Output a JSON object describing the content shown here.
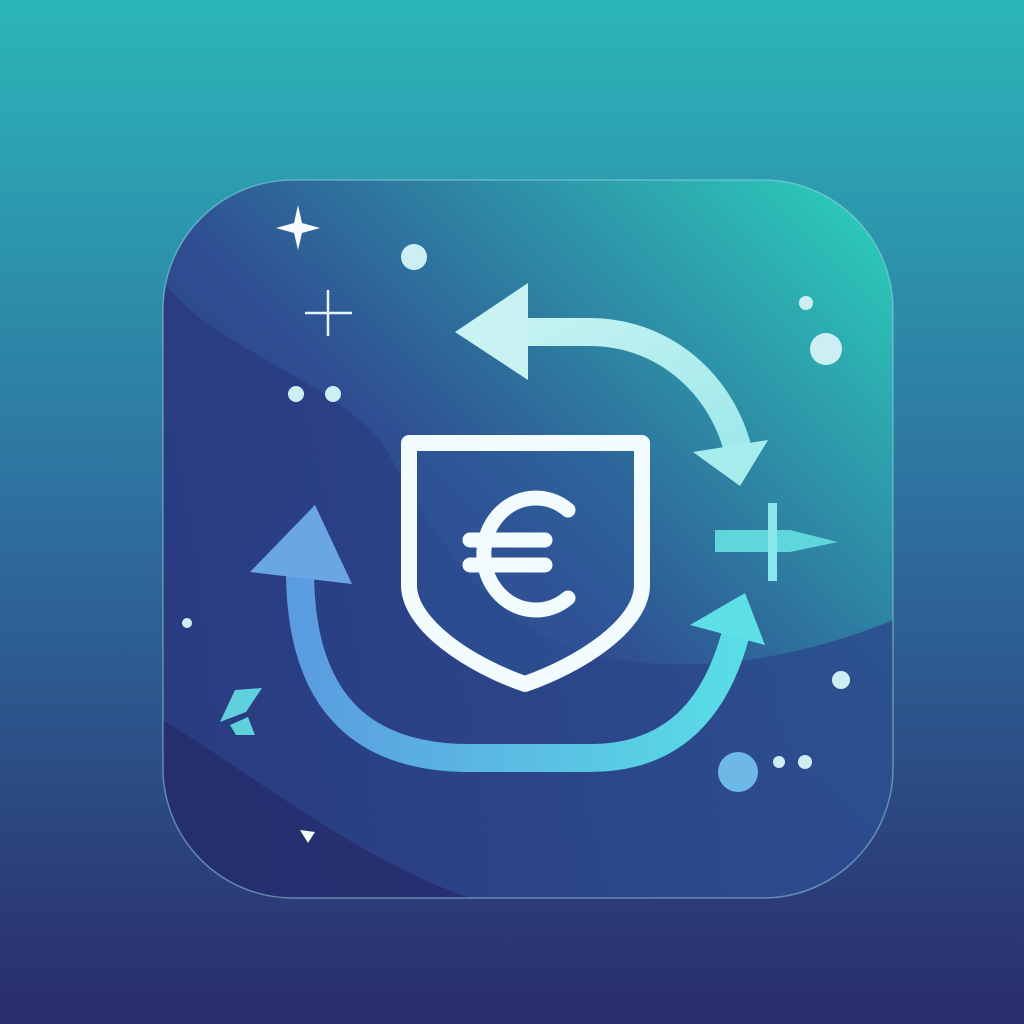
{
  "logo": {
    "glyph": "€",
    "description_role": "app-icon"
  },
  "colors": {
    "bg_top": "#2bb6b9",
    "bg_bottom": "#2a2c6c",
    "tile_top_right": "#2cc7b9",
    "tile_left": "#2f4f92",
    "tile_bottom": "#283070",
    "arrow_light": "#a9eef0",
    "arrow_mid": "#5ab9e6",
    "shield_stroke": "#f2fbfd"
  },
  "icons": [
    "shield-icon",
    "euro-icon",
    "refresh-arrows-icon",
    "sparkle-icon",
    "leaf-icon"
  ]
}
